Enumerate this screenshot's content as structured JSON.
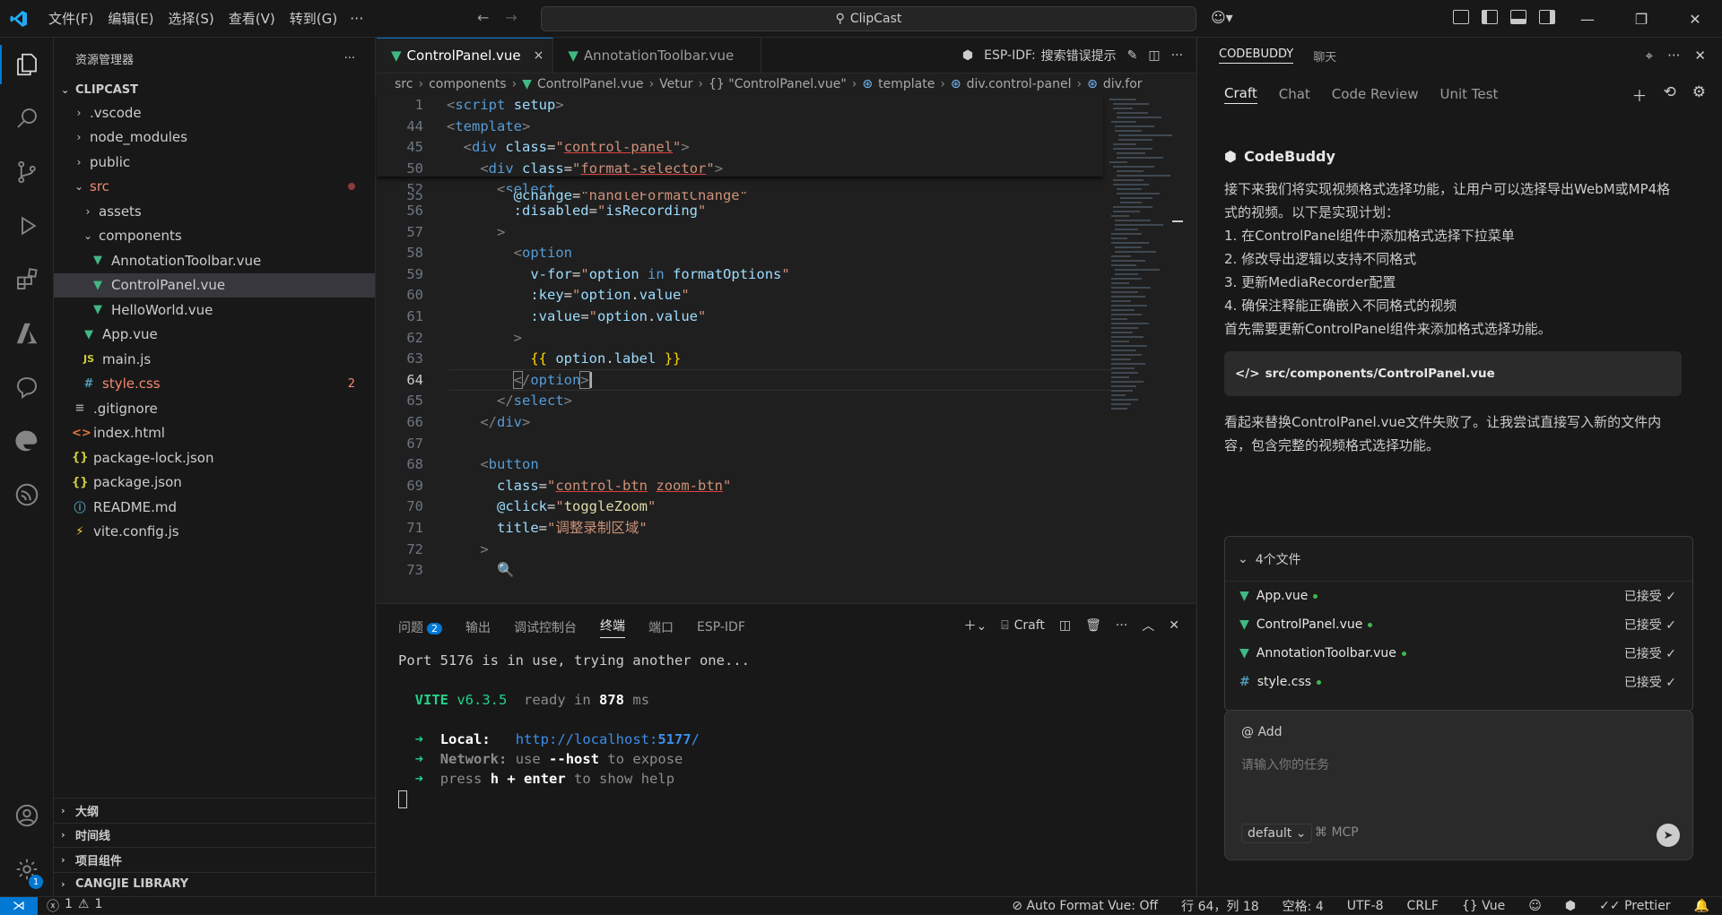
{
  "titlebar": {
    "menus": [
      "文件(F)",
      "编辑(E)",
      "选择(S)",
      "查看(V)",
      "转到(G)"
    ],
    "more": "···",
    "search_text": "ClipCast"
  },
  "explorer": {
    "title": "资源管理器",
    "root": "CLIPCAST",
    "items": [
      {
        "label": ".vscode",
        "kind": "folder",
        "state": "collapsed"
      },
      {
        "label": "node_modules",
        "kind": "folder",
        "state": "collapsed"
      },
      {
        "label": "public",
        "kind": "folder",
        "state": "collapsed"
      },
      {
        "label": "src",
        "kind": "folder",
        "state": "expanded"
      },
      {
        "label": "assets",
        "kind": "folder",
        "state": "collapsed"
      },
      {
        "label": "components",
        "kind": "folder",
        "state": "expanded"
      },
      {
        "label": "AnnotationToolbar.vue",
        "kind": "vue"
      },
      {
        "label": "ControlPanel.vue",
        "kind": "vue",
        "selected": true
      },
      {
        "label": "HelloWorld.vue",
        "kind": "vue"
      },
      {
        "label": "App.vue",
        "kind": "vue"
      },
      {
        "label": "main.js",
        "kind": "js",
        "icon": "JS"
      },
      {
        "label": "style.css",
        "kind": "css",
        "icon": "#",
        "badge": "2"
      },
      {
        "label": ".gitignore",
        "kind": "git"
      },
      {
        "label": "index.html",
        "kind": "html",
        "icon": "<>"
      },
      {
        "label": "package-lock.json",
        "kind": "json",
        "icon": "{}"
      },
      {
        "label": "package.json",
        "kind": "json",
        "icon": "{}"
      },
      {
        "label": "README.md",
        "kind": "info",
        "icon": "ⓘ"
      },
      {
        "label": "vite.config.js",
        "kind": "vite"
      }
    ],
    "sections": [
      "大纲",
      "时间线",
      "项目组件",
      "CANGJIE LIBRARY"
    ]
  },
  "editor": {
    "tabs": [
      "ControlPanel.vue",
      "AnnotationToolbar.vue"
    ],
    "tab_close": "×",
    "tab_actions": {
      "espidf": "ESP-IDF:",
      "search_hint": "搜索错误提示"
    },
    "breadcrumb": [
      "src",
      "components",
      "ControlPanel.vue",
      "Vetur",
      "{} \"ControlPanel.vue\"",
      "template",
      "div.control-panel",
      "div.for"
    ],
    "line_numbers": [
      "1",
      "44",
      "45",
      "50",
      "52",
      "55",
      "56",
      "57",
      "58",
      "59",
      "60",
      "61",
      "62",
      "63",
      "64",
      "65",
      "66",
      "67",
      "68",
      "69",
      "70",
      "71",
      "72",
      "73"
    ]
  },
  "panel": {
    "tabs": [
      "问题",
      "输出",
      "调试控制台",
      "终端",
      "端口",
      "ESP-IDF"
    ],
    "problems_count": "2",
    "craft_label": "Craft",
    "terminal": {
      "port_msg": "Port 5176 is in use, trying another one...",
      "vite": "VITE",
      "version": "v6.3.5",
      "ready": "ready in",
      "ready_ms": "878",
      "ms": "ms",
      "arrow": "➜",
      "local_label": "Local:",
      "local_url_prefix": "http://localhost:",
      "local_port": "5177",
      "local_url_suffix": "/",
      "network_label": "Network:",
      "network_use": "use",
      "network_flag": "--host",
      "network_expose": "to expose",
      "press": "press",
      "h_enter": "h + enter",
      "show_help": "to show help"
    }
  },
  "rightbar": {
    "head_tabs": [
      "CODEBUDDY",
      "聊天"
    ],
    "tabs": [
      "Craft",
      "Chat",
      "Code Review",
      "Unit Test"
    ],
    "assistant": "CodeBuddy",
    "message_1": "接下来我们将实现视频格式选择功能，让用户可以选择导出WebM或MP4格式的视频。以下是实现计划：",
    "plan": [
      "1. 在ControlPanel组件中添加格式选择下拉菜单",
      "2. 修改导出逻辑以支持不同格式",
      "3. 更新MediaRecorder配置",
      "4. 确保注释能正确嵌入不同格式的视频"
    ],
    "message_2": "首先需要更新ControlPanel组件来添加格式选择功能。",
    "file_card": "src/components/ControlPanel.vue",
    "file_card_icon": "</>",
    "message_3": "看起来替换ControlPanel.vue文件失败了。让我尝试直接写入新的文件内容，包含完整的视频格式选择功能。",
    "files_header": "4个文件",
    "files": [
      {
        "name": "App.vue",
        "icon": "vue",
        "status": "已接受"
      },
      {
        "name": "ControlPanel.vue",
        "icon": "vue",
        "status": "已接受"
      },
      {
        "name": "AnnotationToolbar.vue",
        "icon": "vue",
        "status": "已接受"
      },
      {
        "name": "style.css",
        "icon": "css",
        "status": "已接受"
      }
    ],
    "input_add": "@ Add",
    "input_placeholder": "请输入你的任务",
    "mode": "default",
    "mcp": "MCP"
  },
  "statusbar": {
    "errors": "1",
    "warnings": "1",
    "auto_format": "Auto Format Vue: Off",
    "position": "行 64，列 18",
    "spaces": "空格: 4",
    "encoding": "UTF-8",
    "eol": "CRLF",
    "language": "Vue",
    "prettier": "Prettier"
  },
  "colors": {
    "accent": "#0078d4",
    "vue": "#41b883",
    "error": "#f48771"
  }
}
